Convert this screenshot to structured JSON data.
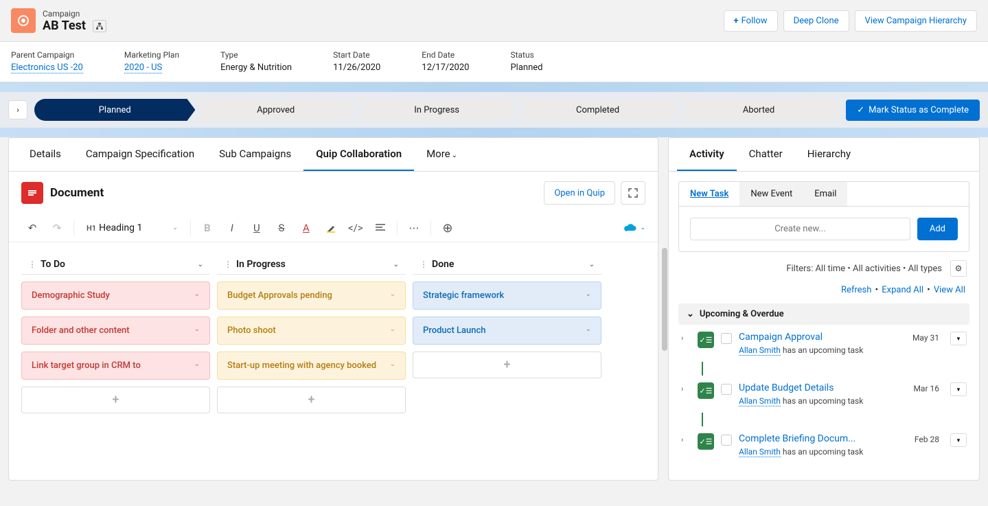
{
  "header": {
    "category": "Campaign",
    "name": "AB Test",
    "actions": {
      "follow": "Follow",
      "clone": "Deep Clone",
      "hierarchy": "View Campaign Hierarchy"
    }
  },
  "info": {
    "parent": {
      "label": "Parent Campaign",
      "value": "Electronics US -20"
    },
    "plan": {
      "label": "Marketing Plan",
      "value": "2020 - US"
    },
    "type": {
      "label": "Type",
      "value": "Energy & Nutrition"
    },
    "start": {
      "label": "Start Date",
      "value": "11/26/2020"
    },
    "end": {
      "label": "End Date",
      "value": "12/17/2020"
    },
    "status": {
      "label": "Status",
      "value": "Planned"
    }
  },
  "path": {
    "stages": [
      "Planned",
      "Approved",
      "In Progress",
      "Completed",
      "Aborted"
    ],
    "button": "Mark Status as Complete"
  },
  "tabs": {
    "details": "Details",
    "spec": "Campaign Specification",
    "sub": "Sub Campaigns",
    "quip": "Quip Collaboration",
    "more": "More"
  },
  "doc": {
    "title": "Document",
    "open": "Open in Quip",
    "heading": "Heading 1",
    "board": {
      "cols": [
        "To Do",
        "In Progress",
        "Done"
      ],
      "todo": [
        "Demographic Study",
        "Folder and other content",
        "Link target group in CRM to"
      ],
      "inprogress": [
        "Budget Approvals pending",
        "Photo shoot",
        "Start-up meeting with agency booked"
      ],
      "done": [
        "Strategic framework",
        "Product Launch"
      ]
    }
  },
  "side": {
    "tabs": {
      "activity": "Activity",
      "chatter": "Chatter",
      "hierarchy": "Hierarchy"
    },
    "activity_tabs": {
      "task": "New Task",
      "event": "New Event",
      "email": "Email"
    },
    "placeholder": "Create new...",
    "add": "Add",
    "filters": "Filters: All time • All activities • All types",
    "links": {
      "refresh": "Refresh",
      "expand": "Expand All",
      "view": "View All"
    },
    "section": "Upcoming & Overdue",
    "tasks": [
      {
        "title": "Campaign Approval",
        "owner": "Allan Smith",
        "sub": "has an upcoming task",
        "date": "May 31"
      },
      {
        "title": "Update Budget Details",
        "owner": "Allan Smith",
        "sub": "has an upcoming task",
        "date": "Mar 16"
      },
      {
        "title": "Complete Briefing Docum...",
        "owner": "Allan Smith",
        "sub": "has an upcoming task",
        "date": "Feb 28"
      }
    ]
  }
}
